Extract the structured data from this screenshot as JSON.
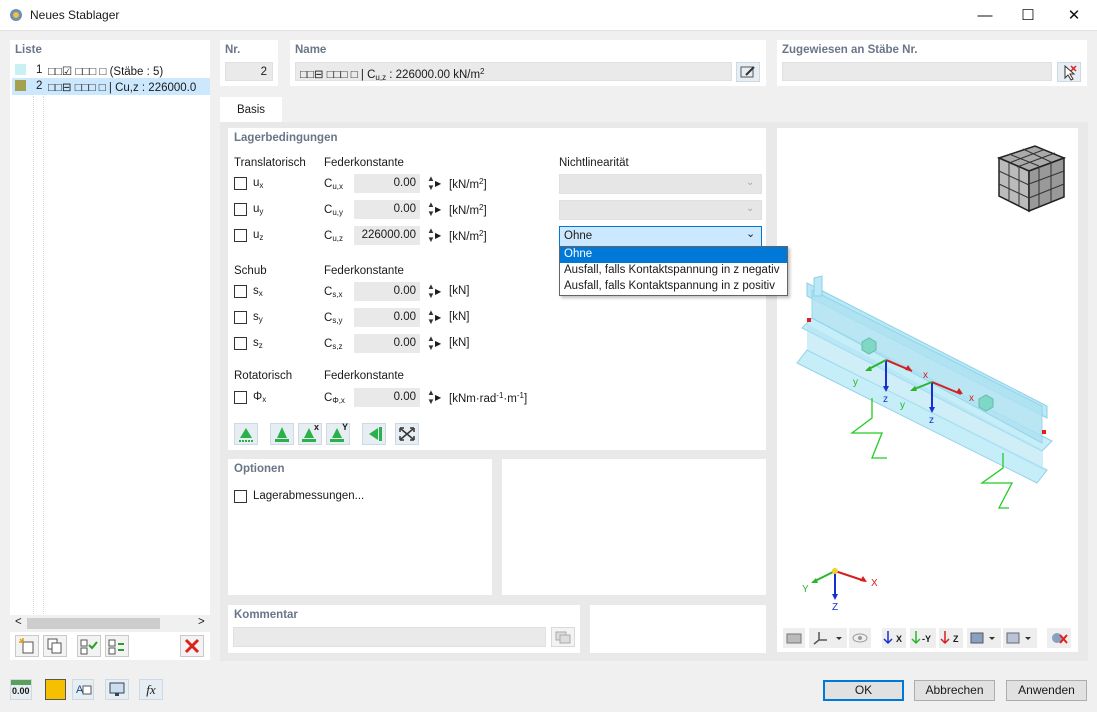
{
  "window": {
    "title": "Neues Stablager",
    "minimize_glyph": "—",
    "maximize_glyph": "☐",
    "close_glyph": "✕"
  },
  "list": {
    "title": "Liste",
    "items": [
      {
        "num": "1",
        "text": "□□☑ □□□ □ (Stäbe : 5)",
        "color": "#c9f1f4"
      },
      {
        "num": "2",
        "text": "□□⊟ □□□ □ | Cu,z : 226000.0",
        "color": "#a5a14e"
      }
    ],
    "scroll_left": "<",
    "scroll_right": ">"
  },
  "nr": {
    "label": "Nr.",
    "value": "2"
  },
  "name": {
    "label": "Name",
    "value_prefix": "□□⊟ □□□ □ | C",
    "value_sub": "u,z",
    "value_rest": " : 226000.00 kN/m",
    "value_sup": "2"
  },
  "assigned": {
    "label": "Zugewiesen an Stäbe Nr.",
    "value": ""
  },
  "tabs": [
    {
      "label": "Basis"
    }
  ],
  "support": {
    "title": "Lagerbedingungen",
    "translatorisch": {
      "header": "Translatorisch",
      "spring_header": "Federkonstante",
      "nonlin_header": "Nichtlinearität",
      "rows": [
        {
          "dof": "u",
          "dof_sub": "x",
          "const": "C",
          "const_sub": "u,x",
          "value": "0.00",
          "unit": "[kN/m",
          "unit_sup": "2",
          "unit_end": "]"
        },
        {
          "dof": "u",
          "dof_sub": "y",
          "const": "C",
          "const_sub": "u,y",
          "value": "0.00",
          "unit": "[kN/m",
          "unit_sup": "2",
          "unit_end": "]"
        },
        {
          "dof": "u",
          "dof_sub": "z",
          "const": "C",
          "const_sub": "u,z",
          "value": "226000.00",
          "unit": "[kN/m",
          "unit_sup": "2",
          "unit_end": "]"
        }
      ],
      "nonlin_selected": "Ohne",
      "nonlin_options": [
        "Ohne",
        "Ausfall, falls Kontaktspannung in z negativ",
        "Ausfall, falls Kontaktspannung in z positiv"
      ]
    },
    "schub": {
      "header": "Schub",
      "spring_header": "Federkonstante",
      "rows": [
        {
          "dof": "s",
          "dof_sub": "x",
          "const": "C",
          "const_sub": "s,x",
          "value": "0.00",
          "unit": "[kN]"
        },
        {
          "dof": "s",
          "dof_sub": "y",
          "const": "C",
          "const_sub": "s,y",
          "value": "0.00",
          "unit": "[kN]"
        },
        {
          "dof": "s",
          "dof_sub": "z",
          "const": "C",
          "const_sub": "s,z",
          "value": "0.00",
          "unit": "[kN]"
        }
      ]
    },
    "rotatorisch": {
      "header": "Rotatorisch",
      "spring_header": "Federkonstante",
      "rows": [
        {
          "dof": "Φ",
          "dof_sub": "x",
          "const": "C",
          "const_sub": "Φ,x",
          "value": "0.00",
          "unit_a": "[kNm·rad",
          "unit_sup1": "-1",
          "unit_b": "·m",
          "unit_sup2": "-1",
          "unit_c": "]"
        }
      ]
    },
    "tool_icons": [
      "support-hinged-icon",
      "support-fixed-icon",
      "support-x-icon",
      "support-y-icon",
      "support-wall-icon",
      "fit-view-icon"
    ],
    "tool_labels": {
      "x": "x",
      "y": "Y"
    }
  },
  "options": {
    "title": "Optionen",
    "checkbox_label": "Lagerabmessungen..."
  },
  "comment": {
    "title": "Kommentar",
    "value": ""
  },
  "preview": {
    "axis_labels": {
      "x": "x",
      "y": "y",
      "z": "z",
      "X": "X",
      "Y": "Y",
      "Z": "Z"
    },
    "toolbar_labels": {
      "x": "X",
      "y": "-Y",
      "z": "Z"
    }
  },
  "bottom": {
    "value_icon_label": "0.00",
    "ok": "OK",
    "cancel": "Abbrechen",
    "apply": "Anwenden",
    "fx": "fx"
  },
  "colors": {
    "accent": "#0078d7",
    "delete_red": "#e0201b",
    "axis_red": "#d42020",
    "axis_green": "#2ab52a",
    "axis_blue": "#1a2fd0",
    "beam": "#b9e9f6",
    "spring": "#22cc22"
  }
}
